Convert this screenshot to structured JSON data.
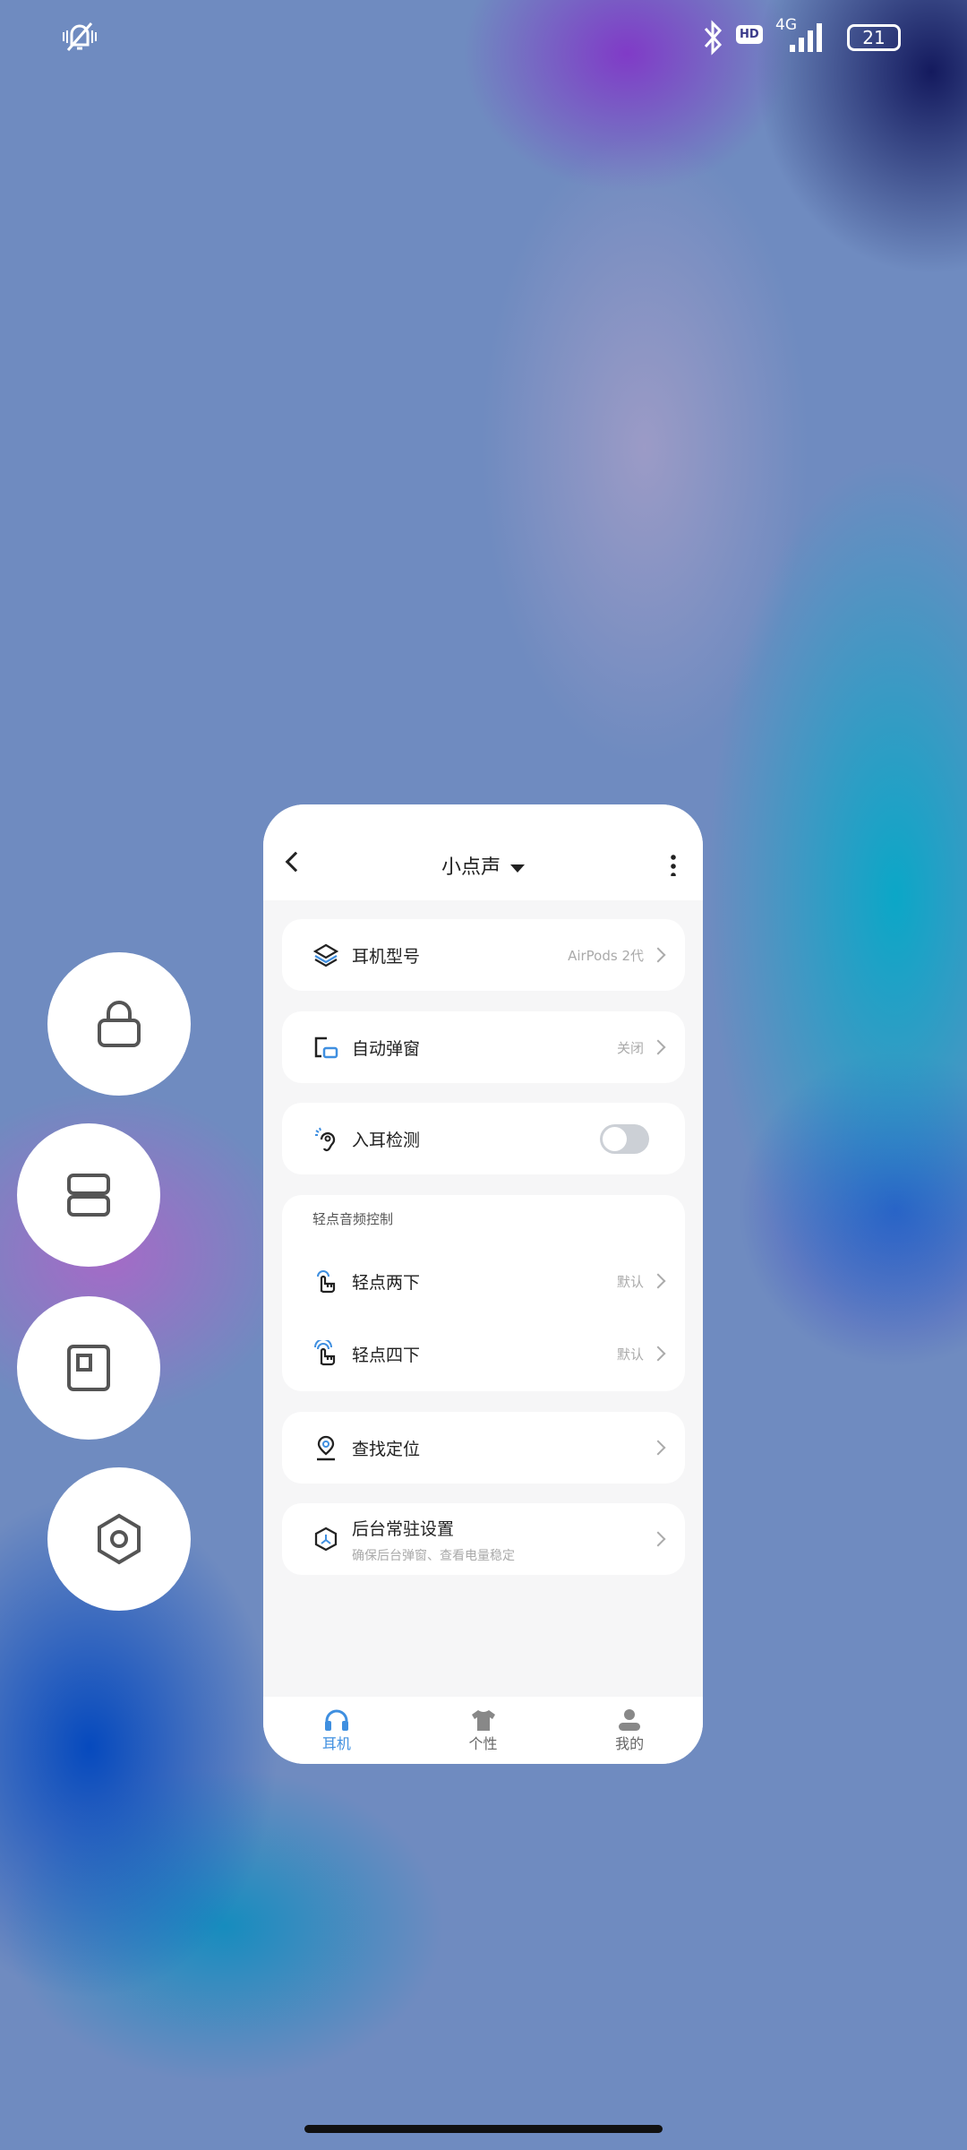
{
  "status_bar": {
    "network": "4G",
    "hd": "HD",
    "battery": "21"
  },
  "app": {
    "title": "小点声",
    "items": [
      {
        "label": "耳机型号",
        "value": "AirPods 2代"
      },
      {
        "label": "自动弹窗",
        "value": "关闭"
      },
      {
        "label": "入耳检测",
        "toggle": false
      }
    ],
    "tap_group": {
      "title": "轻点音频控制",
      "items": [
        {
          "label": "轻点两下",
          "value": "默认"
        },
        {
          "label": "轻点四下",
          "value": "默认"
        }
      ]
    },
    "find": {
      "label": "查找定位"
    },
    "background": {
      "label": "后台常驻设置",
      "sub": "确保后台弹窗、查看电量稳定"
    },
    "nav": [
      {
        "label": "耳机"
      },
      {
        "label": "个性"
      },
      {
        "label": "我的"
      }
    ]
  },
  "colors": {
    "accent": "#3f8fe0"
  }
}
